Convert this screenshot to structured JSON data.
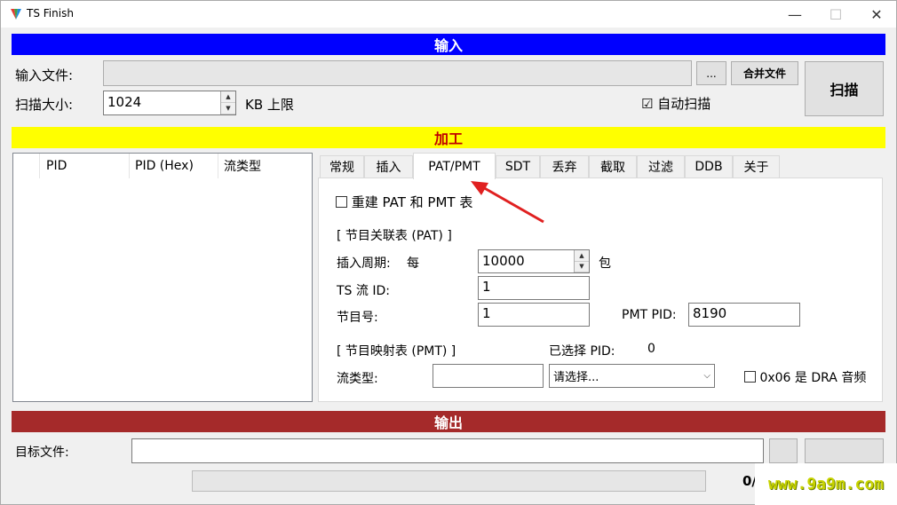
{
  "window": {
    "title": "TS Finish",
    "minimize": "—",
    "maximize": "☐",
    "close": "✕"
  },
  "colors": {
    "input_band": "#0000ff",
    "process_band": "#ffff00",
    "output_band": "#a52a2a"
  },
  "input": {
    "header": "输入",
    "file_label": "输入文件:",
    "file_value": "",
    "browse_label": "...",
    "merge_label": "合并文件",
    "scan_size_label": "扫描大小:",
    "scan_size_value": "1024",
    "kb_label": "KB 上限",
    "auto_scan_label": "自动扫描",
    "auto_scan_checked": "☑",
    "scan_button": "扫描"
  },
  "process": {
    "header": "加工",
    "columns": [
      "PID",
      "PID (Hex)",
      "流类型"
    ],
    "tabs": [
      "常规",
      "插入",
      "PAT/PMT",
      "SDT",
      "丢弃",
      "截取",
      "过滤",
      "DDB",
      "关于"
    ],
    "active_tab": "PAT/PMT",
    "rebuild_label": "重建 PAT 和 PMT 表",
    "pat_group": "[ 节目关联表 (PAT) ]",
    "insert_period_label": "插入周期:",
    "every_label": "每",
    "insert_period_value": "10000",
    "packet_label": "包",
    "ts_id_label": "TS 流 ID:",
    "ts_id_value": "1",
    "program_num_label": "节目号:",
    "program_num_value": "1",
    "pmt_pid_label": "PMT PID:",
    "pmt_pid_value": "8190",
    "pmt_group": "[ 节目映射表 (PMT) ]",
    "selected_pid_label": "已选择 PID:",
    "selected_pid_value": "0",
    "stream_type_label": "流类型:",
    "stream_type_value": "",
    "stream_select": "请选择...",
    "dra_label": "0x06 是 DRA 音频"
  },
  "output": {
    "header": "输出",
    "target_label": "目标文件:",
    "target_value": "",
    "progress_text": "0/",
    "progress": 0
  },
  "watermark": "www.9a9m.com"
}
